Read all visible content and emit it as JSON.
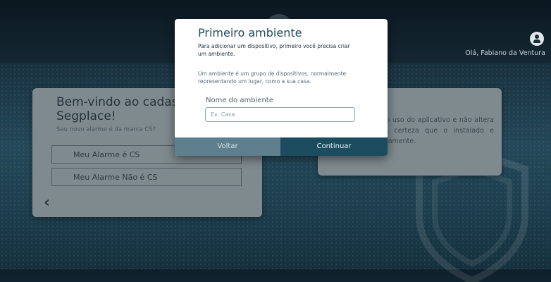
{
  "header": {
    "greeting": "Olá, Fabiano da Ventura"
  },
  "welcome_card": {
    "title": "Bem-vindo ao cadastro Segplace!",
    "subtitle": "Seu novo alarme é da marca CS?",
    "options": [
      {
        "label": "Meu Alarme é CS"
      },
      {
        "label": "Meu Alarme Não é CS"
      }
    ]
  },
  "info_card": {
    "text": "Isto apenas para o uso do aplicativo e não altera o mesmo. Tenha certeza que o instalado e configurado corretamente."
  },
  "modal": {
    "title": "Primeiro ambiente",
    "description": "Para adicionar um dispositivo, primeiro você precisa criar um ambiente.",
    "help": "Um ambiente é um grupo de dispositivos, normalmente representando um lugar, como a sua casa.",
    "field_label": "Nome do ambiente",
    "field_placeholder": "Ex. Casa",
    "back_label": "Voltar",
    "continue_label": "Continuar"
  },
  "colors": {
    "accent": "#1c4c5f",
    "secondary_button": "#5e808e",
    "card": "#7f8a8e"
  }
}
